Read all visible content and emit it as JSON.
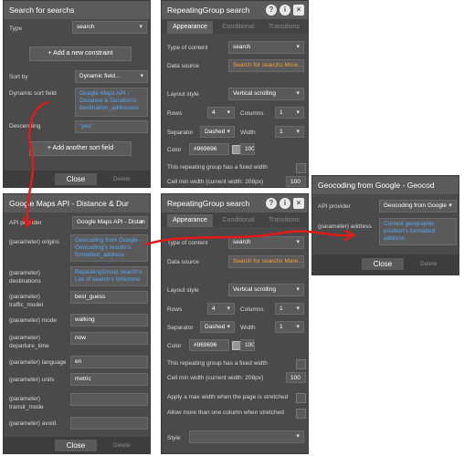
{
  "p1": {
    "title": "Search for searchs",
    "type_label": "Type",
    "type_value": "search",
    "add_constraint": "+ Add a new constraint",
    "sort_by_label": "Sort by",
    "sort_by_value": "Dynamic field...",
    "dyn_sort_label": "Dynamic sort field",
    "dyn_sort_value": "Google Maps API - Distance & Duration's destination_addresses",
    "descending_label": "Descending",
    "descending_value": "\"yes\"",
    "add_sort": "+ Add another sort field",
    "close": "Close",
    "delete": "Delete"
  },
  "p2": {
    "title": "RepeatingGroup search",
    "tabs": [
      "Appearance",
      "Conditional",
      "Transitions"
    ],
    "type_label": "Type of content",
    "type_value": "search",
    "source_label": "Data source",
    "source_value": "Search for searchs More...",
    "layout_label": "Layout style",
    "layout_value": "Vertical scrolling",
    "rows_label": "Rows",
    "rows_value": "4",
    "cols_label": "Columns",
    "cols_value": "1",
    "sep_label": "Separator",
    "sep_value": "Dashed",
    "width_label": "Width",
    "width_value": "1",
    "color_label": "Color",
    "color_value": "#969696",
    "color_pct": "100",
    "fixed_label": "This repeating group has a fixed width",
    "min_label": "Cell min width (current width: 208px)",
    "min_value": "100"
  },
  "p3": {
    "title": "Google Maps API - Distance & Dur",
    "api_label": "API provider",
    "api_value": "Google Maps API - Distan",
    "params": [
      {
        "label": "(parameter) origins",
        "value": "Geocoding from Google - Geocoding's results's formatted_address",
        "dyn": true
      },
      {
        "label": "(parameter) destinations",
        "value": "RepeatingGroup search's List of search's timezone",
        "dyn": true
      },
      {
        "label": "(parameter) traffic_model",
        "value": "best_guess",
        "dyn": false
      },
      {
        "label": "(parameter) mode",
        "value": "walking",
        "dyn": false
      },
      {
        "label": "(parameter) departure_time",
        "value": "now",
        "dyn": false
      },
      {
        "label": "(parameter) language",
        "value": "en",
        "dyn": false
      },
      {
        "label": "(parameter) units",
        "value": "metric",
        "dyn": false
      },
      {
        "label": "(parameter) transit_mode",
        "value": "",
        "dyn": false
      },
      {
        "label": "(parameter) avoid",
        "value": "",
        "dyn": false
      }
    ],
    "close": "Close",
    "delete": "Delete"
  },
  "p4": {
    "title": "RepeatingGroup search",
    "tabs": [
      "Appearance",
      "Conditional",
      "Transitions"
    ],
    "type_label": "Type of content",
    "type_value": "search",
    "source_label": "Data source",
    "source_value": "Search for searchs More...",
    "layout_label": "Layout style",
    "layout_value": "Vertical scrolling",
    "rows_label": "Rows",
    "rows_value": "4",
    "cols_label": "Columns",
    "cols_value": "1",
    "sep_label": "Separator",
    "sep_value": "Dashed",
    "width_label": "Width",
    "width_value": "1",
    "color_label": "Color",
    "color_value": "#969696",
    "color_pct": "100",
    "fixed_label": "This repeating group has a fixed width",
    "min_label": "Cell min width (current width: 208px)",
    "min_value": "100",
    "max_label": "Apply a max width when the page is stretched",
    "multi_label": "Allow more than one column when stretched",
    "style_label": "Style"
  },
  "p5": {
    "title": "Geocoding from Google - Geocod",
    "api_label": "API provider",
    "api_value": "Geocoding from Google -",
    "addr_label": "(parameter) address",
    "addr_value": "Current geographic position's formatted address",
    "close": "Close",
    "delete": "Delete"
  },
  "colors": {
    "panel": "#4a4a4a",
    "dynamic": "#5aa7f2",
    "source": "#f2a23c",
    "arrow": "#e11a1a"
  }
}
